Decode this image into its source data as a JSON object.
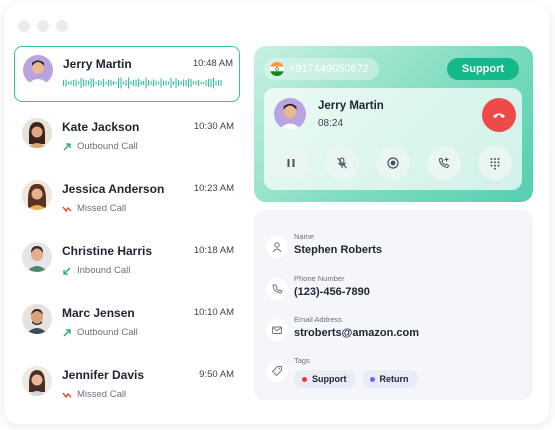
{
  "calls": [
    {
      "name": "Jerry Martin",
      "time": "10:48 AM",
      "type": "",
      "active": true
    },
    {
      "name": "Kate Jackson",
      "time": "10:30 AM",
      "type": "Outbound Call"
    },
    {
      "name": "Jessica Anderson",
      "time": "10:23 AM",
      "type": "Missed Call"
    },
    {
      "name": "Christine Harris",
      "time": "10:18 AM",
      "type": "Inbound Call"
    },
    {
      "name": "Marc Jensen",
      "time": "10:10 AM",
      "type": "Outbound Call"
    },
    {
      "name": "Jennifer Davis",
      "time": "9:50 AM",
      "type": "Missed Call"
    }
  ],
  "call_panel": {
    "phone": "+917449050672",
    "support_label": "Support",
    "caller_name": "Jerry Martin",
    "duration": "08:24",
    "controls": [
      "pause-icon",
      "mute-icon",
      "record-icon",
      "add-call-icon",
      "keypad-icon"
    ]
  },
  "contact": {
    "name_label": "Name",
    "name": "Stephen Roberts",
    "phone_label": "Phone Number",
    "phone": "(123)-456-7890",
    "email_label": "Email Address",
    "email": "stroberts@amazon.com",
    "tags_label": "Tags",
    "tags": [
      {
        "label": "Support",
        "color": "#e53935"
      },
      {
        "label": "Return",
        "color": "#6c63ff"
      }
    ]
  },
  "colors": {
    "accent": "#14b88a",
    "outbound": "#1aa58a",
    "missed": "#e53935",
    "inbound": "#1aa58a",
    "hangup": "#ef4a4a"
  }
}
